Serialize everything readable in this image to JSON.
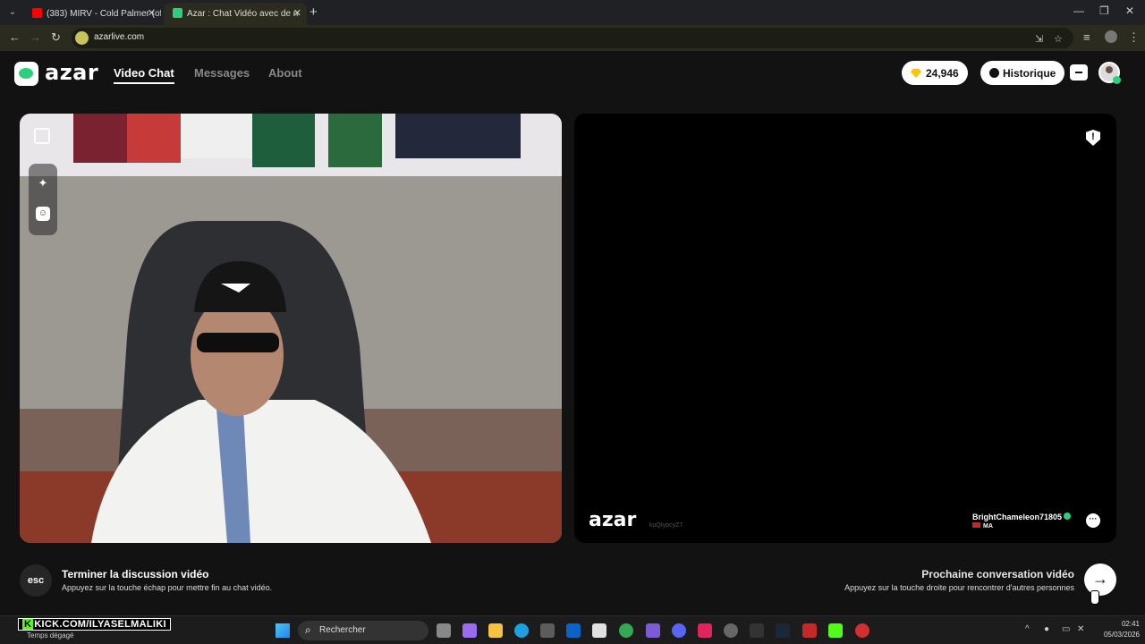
{
  "browser": {
    "tabs": [
      {
        "label": "(383) MIRV - Cold Palmer (offici",
        "favicon_color": "#ff0000"
      },
      {
        "label": "Azar : Chat Vidéo avec de n",
        "favicon_color": "#2ad07a"
      }
    ],
    "url": "azarlive.com"
  },
  "site": {
    "logo_text": "azar",
    "nav": [
      "Video Chat",
      "Messages",
      "About"
    ],
    "gems": "24,946",
    "history_label": "Historique"
  },
  "remote": {
    "logo_text": "azar",
    "session_id": "kuQIypcyZ7",
    "partner_name": "BrightChameleon71805",
    "partner_country": "MA"
  },
  "actions": {
    "esc_label": "esc",
    "end_title": "Terminer la discussion vidéo",
    "end_sub": "Appuyez sur la touche échap pour mettre fin au chat vidéo.",
    "next_title": "Prochaine conversation vidéo",
    "next_sub": "Appuyez sur la touche droite pour rencontrer d'autres personnes"
  },
  "taskbar": {
    "overlay_text": "KICK.COM/ILYASELMALIKI",
    "overlay_k": "K",
    "weather": "Temps dégagé",
    "search_placeholder": "Rechercher",
    "time": "02:41",
    "date": "05/03/2026"
  },
  "colors": {
    "accent_green": "#2ad07a",
    "gem_yellow": "#ffc400"
  }
}
